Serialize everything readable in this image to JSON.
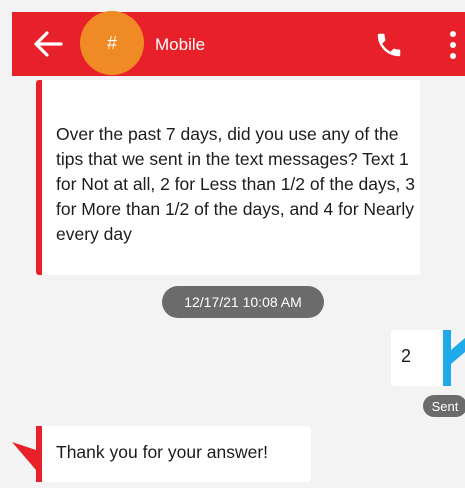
{
  "colors": {
    "toolbar_bg": "#e8202a",
    "avatar_bg": "#f08a24",
    "incoming_accent": "#e8202a",
    "outgoing_accent": "#1ea9e8",
    "pill_bg": "#6b6b6b",
    "background": "#f3f3f3"
  },
  "toolbar": {
    "back_icon": "arrow-left-icon",
    "avatar_initial": "#",
    "contact_name": "Mobile",
    "call_icon": "phone-icon",
    "more_icon": "more-vertical-icon"
  },
  "conversation": {
    "incoming_1": {
      "text": "Over the past 7 days, did you use any of the tips that we sent in the text messages? Text 1 for Not at all, 2 for Less than 1/2 of the days, 3 for More than 1/2 of the days, and 4 for Nearly every day"
    },
    "timestamp": "12/17/21 10:08 AM",
    "outgoing_1": {
      "text": "2",
      "status": "Sent"
    },
    "incoming_2": {
      "text": "Thank you for your answer!"
    }
  }
}
